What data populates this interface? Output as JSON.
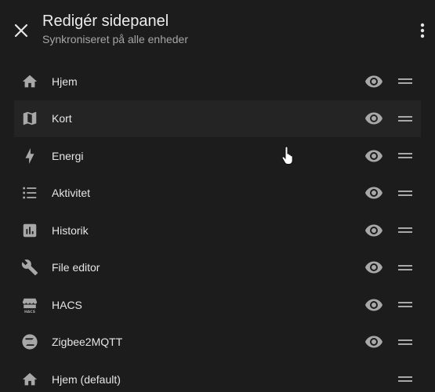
{
  "header": {
    "title": "Redigér sidepanel",
    "subtitle": "Synkroniseret på alle enheder"
  },
  "items": [
    {
      "label": "Hjem",
      "icon": "home-icon",
      "visible_toggle": true
    },
    {
      "label": "Kort",
      "icon": "map-icon",
      "visible_toggle": true
    },
    {
      "label": "Energi",
      "icon": "lightning-bolt-icon",
      "visible_toggle": true
    },
    {
      "label": "Aktivitet",
      "icon": "format-list-bulleted-icon",
      "visible_toggle": true
    },
    {
      "label": "Historik",
      "icon": "chart-box-icon",
      "visible_toggle": true
    },
    {
      "label": "File editor",
      "icon": "wrench-icon",
      "visible_toggle": true
    },
    {
      "label": "HACS",
      "icon": "hacs-store-icon",
      "visible_toggle": true
    },
    {
      "label": "Zigbee2MQTT",
      "icon": "zigbee-icon",
      "visible_toggle": true
    },
    {
      "label": "Hjem (default)",
      "icon": "home-icon",
      "visible_toggle": false
    }
  ],
  "colors": {
    "background": "#1c1c1c",
    "hover_row": "#242424",
    "icon": "#a8a8a8",
    "text": "#e6e6e6"
  }
}
